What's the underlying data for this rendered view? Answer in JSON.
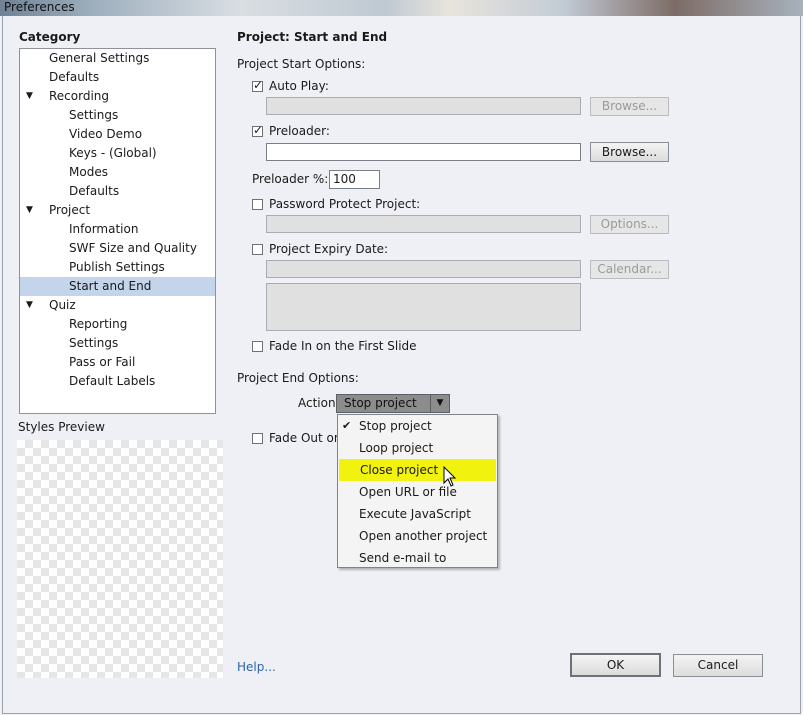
{
  "window": {
    "title": "Preferences"
  },
  "category": {
    "heading": "Category",
    "items": [
      {
        "label": "General Settings",
        "level": 1
      },
      {
        "label": "Defaults",
        "level": 1
      },
      {
        "label": "Recording",
        "level": 0,
        "expanded": true
      },
      {
        "label": "Settings",
        "level": 2
      },
      {
        "label": "Video Demo",
        "level": 2
      },
      {
        "label": "Keys - (Global)",
        "level": 2
      },
      {
        "label": "Modes",
        "level": 2
      },
      {
        "label": "Defaults",
        "level": 2
      },
      {
        "label": "Project",
        "level": 0,
        "expanded": true
      },
      {
        "label": "Information",
        "level": 2
      },
      {
        "label": "SWF Size and Quality",
        "level": 2
      },
      {
        "label": "Publish Settings",
        "level": 2
      },
      {
        "label": "Start and End",
        "level": 2,
        "selected": true
      },
      {
        "label": "Quiz",
        "level": 0,
        "expanded": true
      },
      {
        "label": "Reporting",
        "level": 2
      },
      {
        "label": "Settings",
        "level": 2
      },
      {
        "label": "Pass or Fail",
        "level": 2
      },
      {
        "label": "Default Labels",
        "level": 2
      }
    ]
  },
  "styles_preview": {
    "label": "Styles Preview"
  },
  "panel": {
    "title": "Project: Start and End",
    "start_options_label": "Project Start Options:",
    "auto_play": {
      "label": "Auto Play:",
      "checked": true,
      "value": "",
      "browse_label": "Browse..."
    },
    "preloader": {
      "label": "Preloader:",
      "checked": true,
      "value": "",
      "browse_label": "Browse..."
    },
    "preloader_percent": {
      "label": "Preloader %:",
      "value": "100"
    },
    "password": {
      "label": "Password Protect Project:",
      "checked": false,
      "value": "",
      "options_label": "Options..."
    },
    "expiry": {
      "label": "Project Expiry Date:",
      "checked": false,
      "value": "",
      "calendar_label": "Calendar..."
    },
    "fade_in": {
      "label": "Fade In on the First Slide",
      "checked": false
    },
    "end_options_label": "Project End Options:",
    "action": {
      "label": "Action:",
      "selected": "Stop project",
      "options": [
        "Stop project",
        "Loop project",
        "Close project",
        "Open URL or file",
        "Execute JavaScript",
        "Open another project",
        "Send e-mail to"
      ],
      "checked_option": "Stop project",
      "highlighted_option": "Close project"
    },
    "fade_out": {
      "label": "Fade Out on",
      "checked": false
    }
  },
  "footer": {
    "help_label": "Help...",
    "ok_label": "OK",
    "cancel_label": "Cancel"
  },
  "colors": {
    "selection": "#c4d4ea",
    "menu_highlight": "#f2f20f",
    "link": "#2f64a8"
  }
}
